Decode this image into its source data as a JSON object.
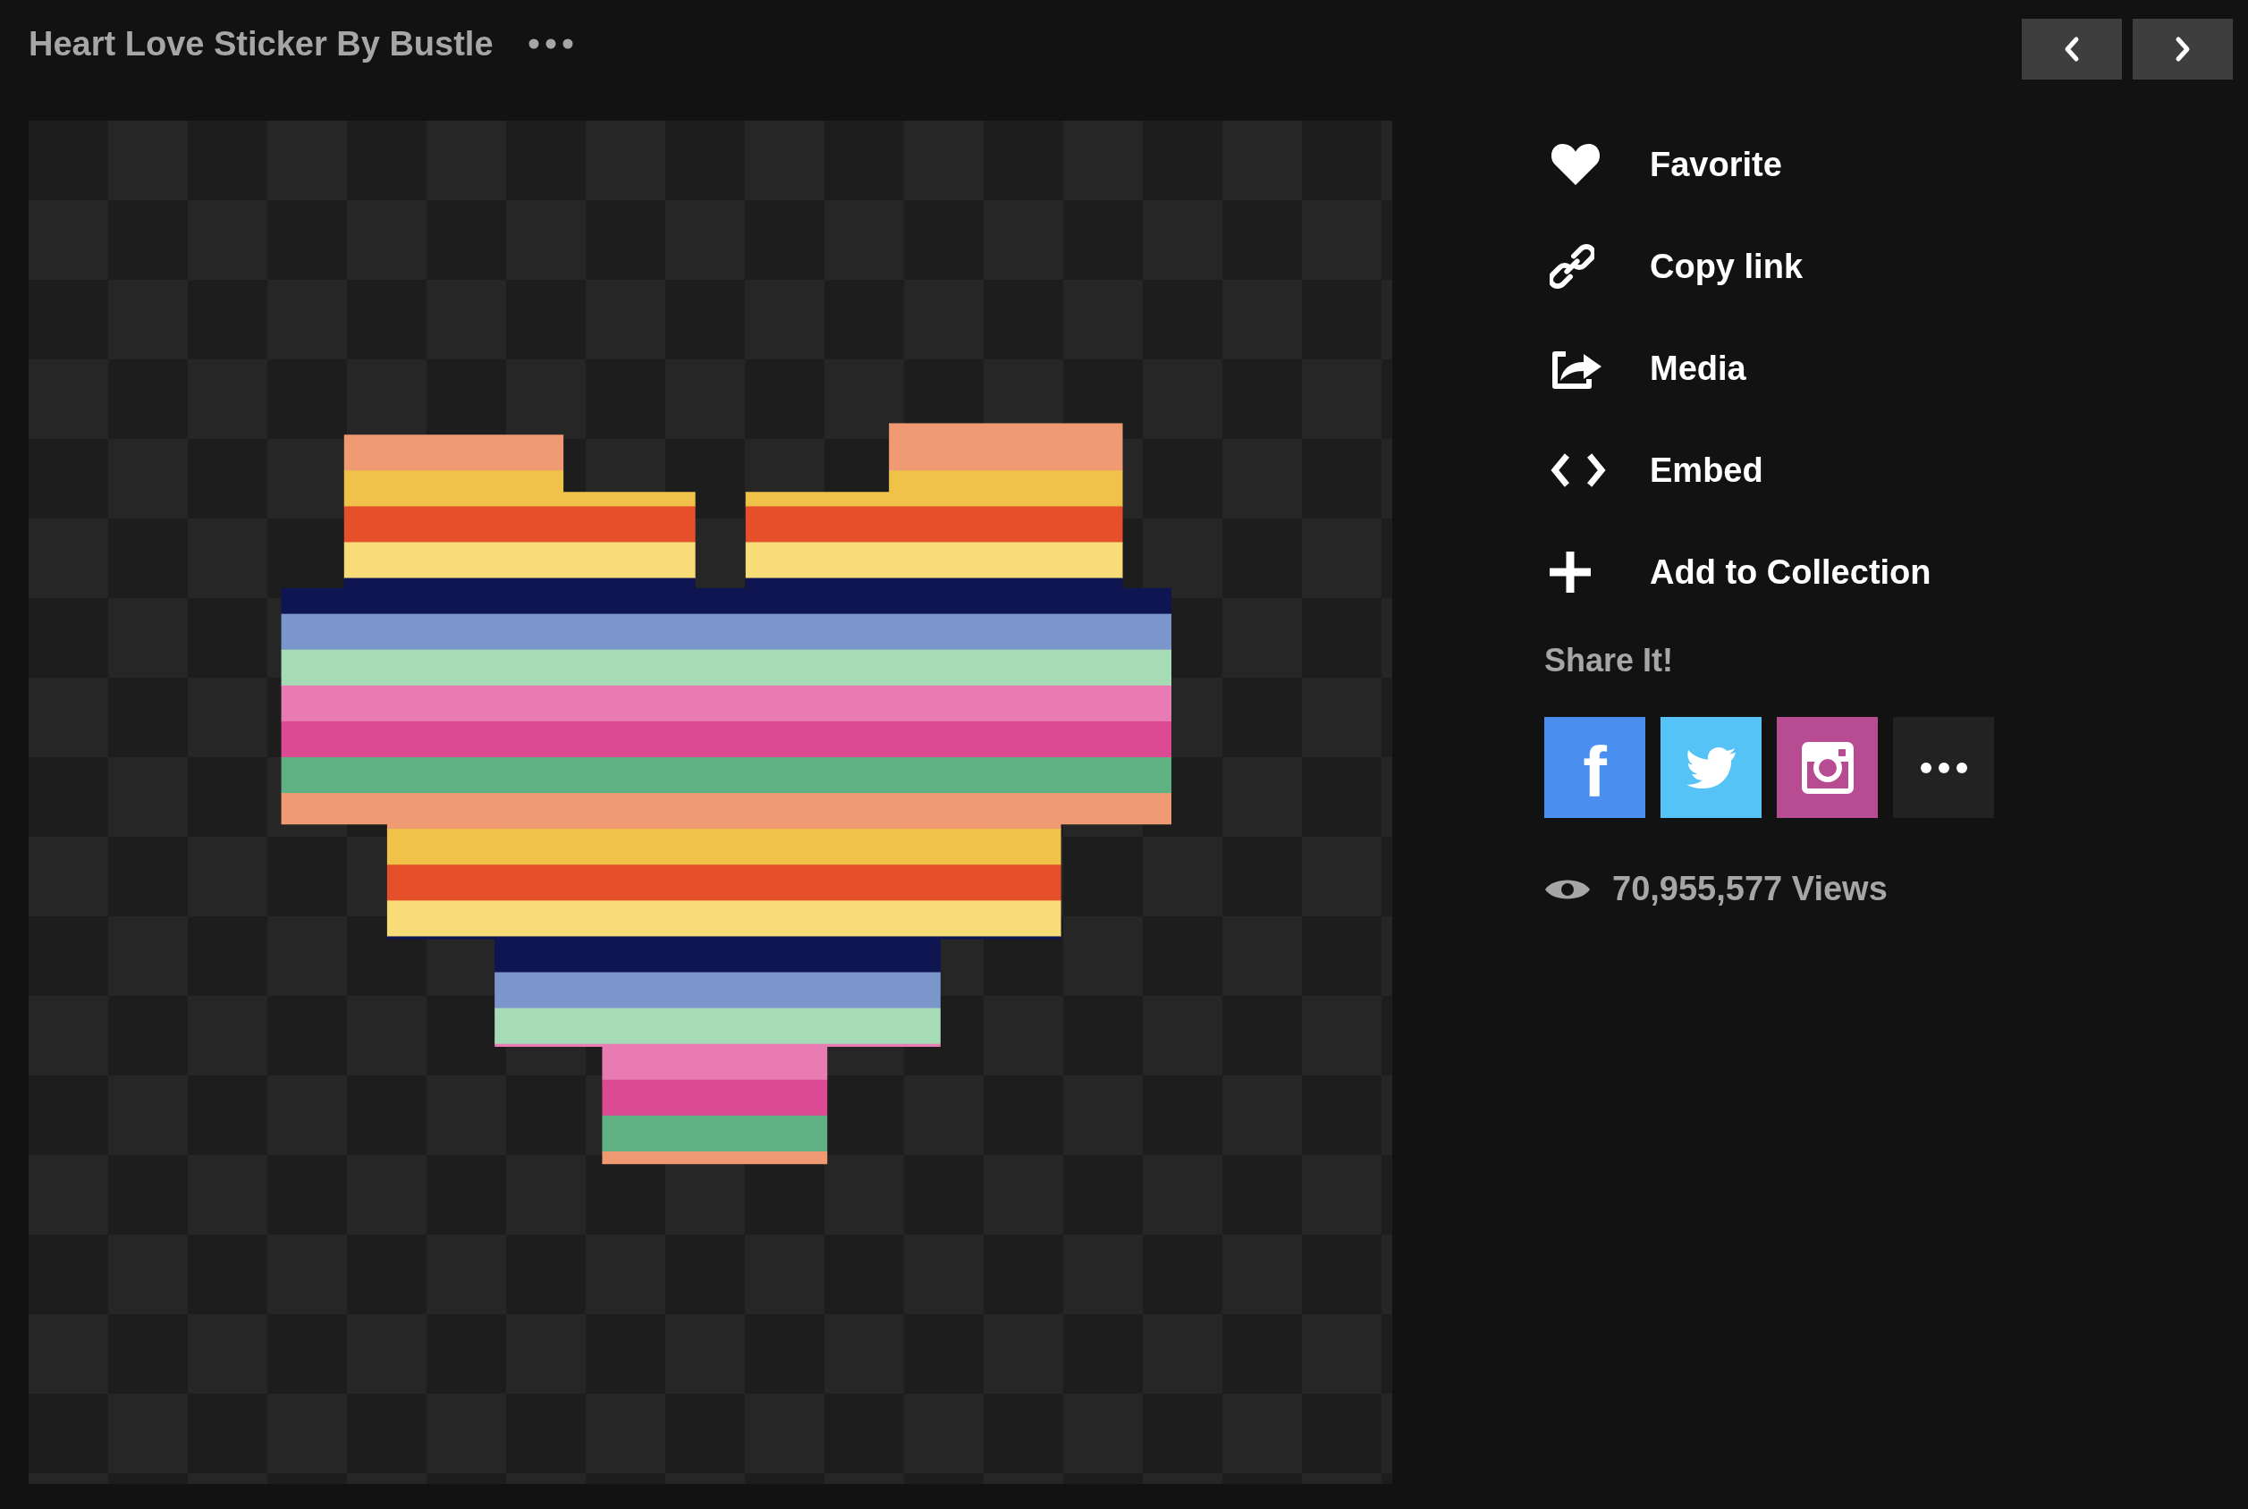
{
  "title": "Heart Love Sticker By Bustle",
  "navigation": [
    {
      "kind": "previous"
    },
    {
      "kind": "next"
    }
  ],
  "actions": [
    {
      "kind": "favorite",
      "label": "Favorite"
    },
    {
      "kind": "link",
      "label": "Copy link"
    },
    {
      "kind": "media",
      "label": "Media"
    },
    {
      "kind": "embed",
      "label": "Embed"
    },
    {
      "kind": "add",
      "label": "Add to Collection"
    }
  ],
  "share": {
    "heading": "Share It!",
    "buttons": [
      {
        "kind": "facebook",
        "color": "#4a8ff0",
        "label": "f"
      },
      {
        "kind": "twitter",
        "color": "#55c3f5"
      },
      {
        "kind": "instagram",
        "color": "#b84c92"
      },
      {
        "kind": "more",
        "color": "#222222"
      }
    ]
  },
  "views": "70,955,577 Views"
}
